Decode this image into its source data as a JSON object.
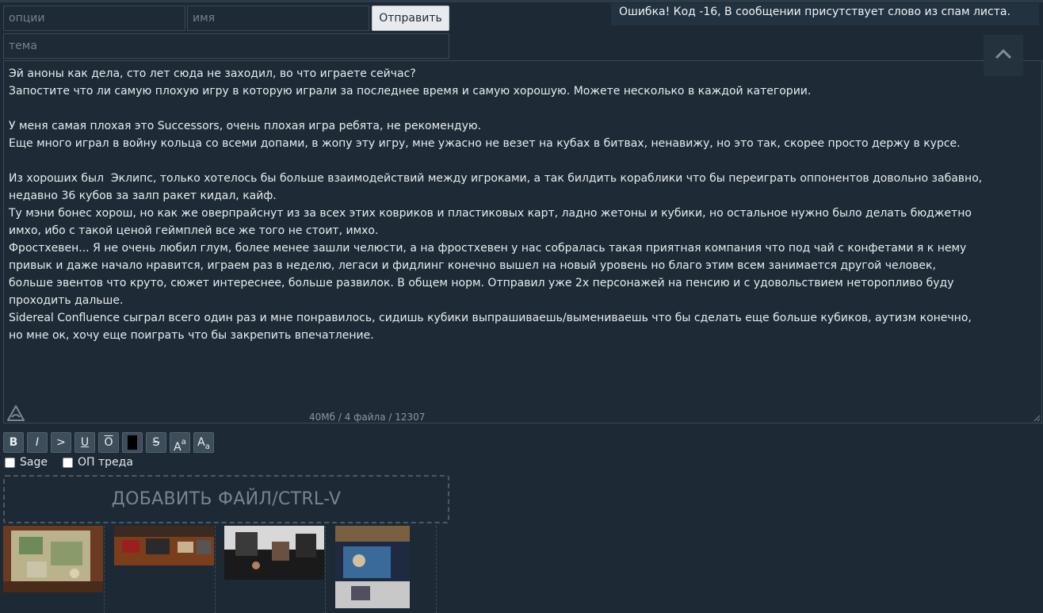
{
  "form": {
    "options_placeholder": "опции",
    "name_placeholder": "имя",
    "subject_placeholder": "тема",
    "send_label": "Отправить"
  },
  "error": {
    "text": "Ошибка! Код -16, В сообщении присутствует слово из спам листа."
  },
  "message": {
    "text": "Эй аноны как дела, сто лет сюда не заходил, во что играете сейчас?\nЗапостите что ли самую плохую игру в которую играли за последнее время и самую хорошую. Можете несколько в каждой категории.\n\nУ меня самая плохая это Successors, очень плохая игра ребята, не рекомендую.\nЕще много играл в войну кольца со всеми допами, в жопу эту игру, мне ужасно не везет на кубах в битвах, ненавижу, но это так, скорее просто держу в курсе.\n\nИз хороших был  Эклипс, только хотелось бы больше взаимодействий между игроками, а так билдить кораблики что бы переиграть оппонентов довольно забавно,\nнедавно 36 кубов за залп ракет кидал, кайф.\nТу мэни бонес хорош, но как же оверпрайснут из за всех этих ковриков и пластиковых карт, ладно жетоны и кубики, но остальное нужно было делать бюджетно\nимхо, ибо с такой ценой геймплей все же того не стоит, имхо.\nФростхевен... Я не очень любил глум, более менее зашли челюсти, а на фростхевен у нас собралась такая приятная компания что под чай с конфетами я к нему\nпривык и даже начало нравится, играем раз в неделю, легаси и фидлинг конечно вышел на новый уровень но благо этим всем занимается другой человек,\nбольше эвентов что круто, сюжет интереснее, больше развилок. В общем норм. Отправил уже 2х персонажей на пенсию и с удовольствием неторопливо буду\nпроходить дальше.\nSidereal Confluence сыграл всего один раз и мне понравилось, сидишь кубики выпрашиваешь/вымениваешь что бы сделать еще больше кубиков, аутизм конечно,\nно мне ок, хочу еще поиграть что бы закрепить впечатление.",
    "limits": "40Мб / 4 файла / 12307"
  },
  "toolbar": {
    "bold": "B",
    "italic": "I",
    "quote": ">",
    "underline": "U",
    "overline": "O",
    "strike": "S",
    "sup_big": "A",
    "sup_small": "a",
    "sub_big": "A",
    "sub_small": "a"
  },
  "checkboxes": {
    "sage": "Sage",
    "op": "ОП треда"
  },
  "dropzone": {
    "label": "ДОБАВИТЬ ФАЙЛ/CTRL-V"
  },
  "colors": {
    "background": "#1d2a35",
    "field": "#1e2b36",
    "border": "#3a4956",
    "button": "#e8ebee"
  },
  "icons": [
    "triangle-logo-icon",
    "resize-grip-icon",
    "chevron-up-icon"
  ]
}
